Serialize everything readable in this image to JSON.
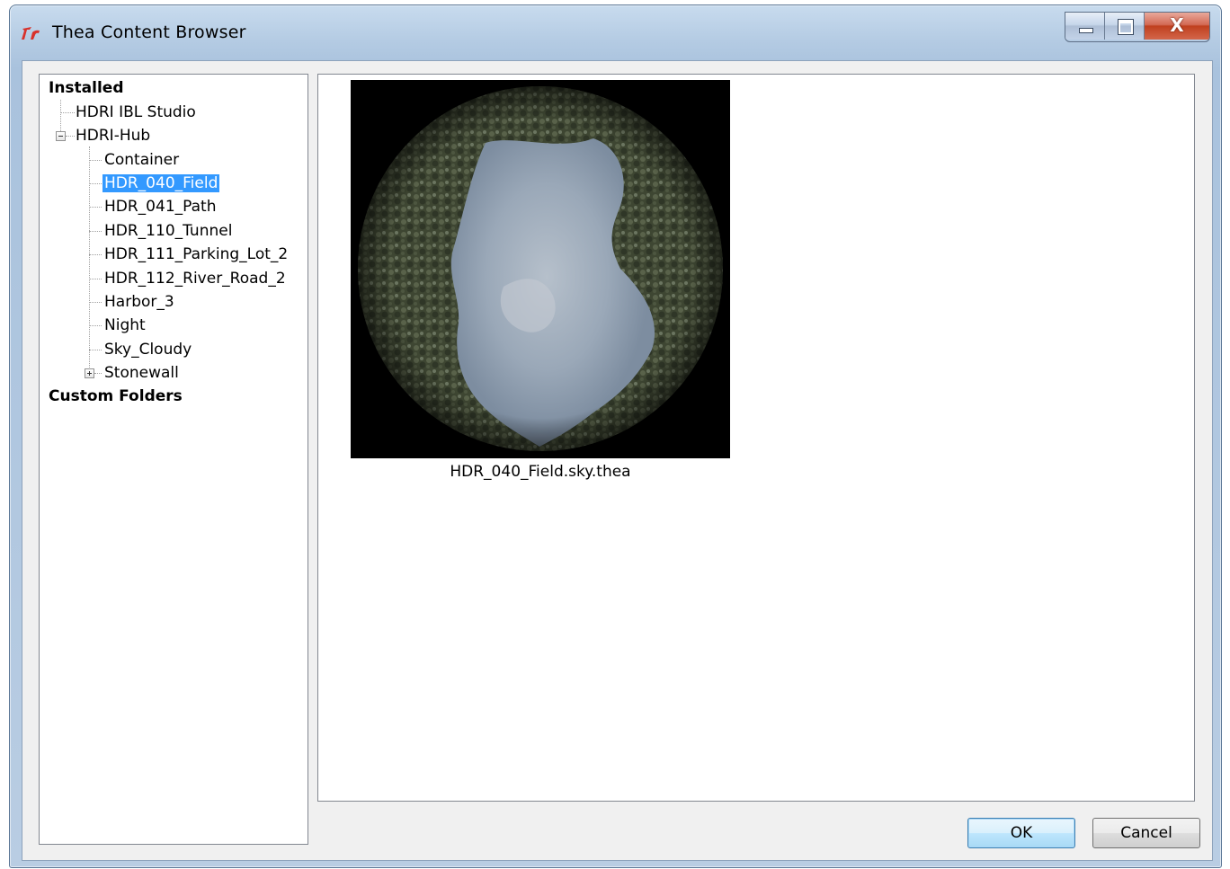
{
  "window": {
    "title": "Thea Content Browser",
    "close_label": "X"
  },
  "tree": {
    "sections": [
      {
        "label": "Installed"
      },
      {
        "label": "Custom Folders"
      }
    ],
    "items": [
      {
        "label": "HDRI IBL Studio"
      },
      {
        "label": "HDRI-Hub"
      },
      {
        "label": "Container"
      },
      {
        "label": "HDR_040_Field"
      },
      {
        "label": "HDR_041_Path"
      },
      {
        "label": "HDR_110_Tunnel"
      },
      {
        "label": "HDR_111_Parking_Lot_2"
      },
      {
        "label": "HDR_112_River_Road_2"
      },
      {
        "label": "Harbor_3"
      },
      {
        "label": "Night"
      },
      {
        "label": "Sky_Cloudy"
      },
      {
        "label": "Stonewall"
      }
    ],
    "selected": "HDR_040_Field"
  },
  "content": {
    "items": [
      {
        "filename": "HDR_040_Field.sky.thea"
      }
    ]
  },
  "buttons": {
    "ok": "OK",
    "cancel": "Cancel"
  },
  "colors": {
    "selection": "#3399ff",
    "close_button": "#c0401f"
  }
}
